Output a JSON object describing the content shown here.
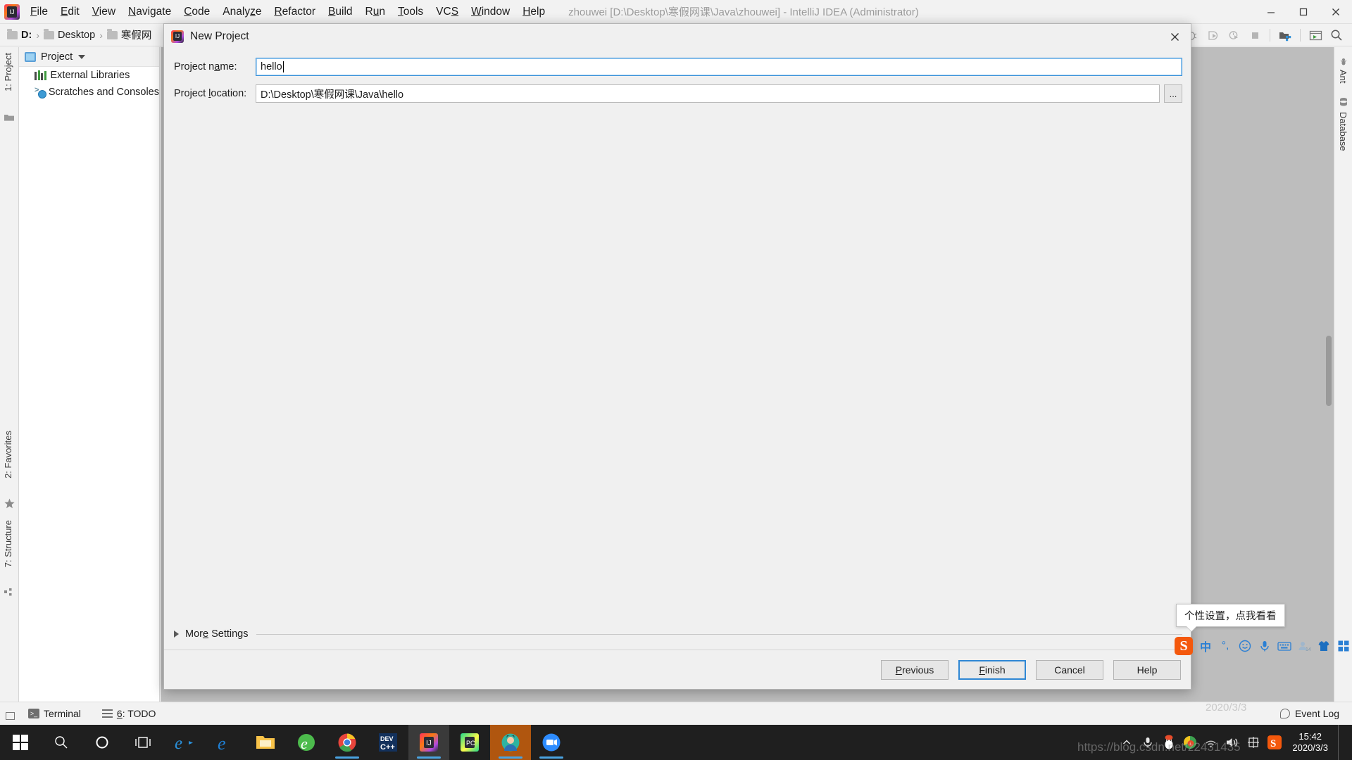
{
  "window": {
    "title": "zhouwei [D:\\Desktop\\寒假网课\\Java\\zhouwei] - IntelliJ IDEA (Administrator)",
    "logo_text": "IJ",
    "controls": {
      "minimize": "minimize-icon",
      "maximize": "maximize-icon",
      "close": "close-icon"
    }
  },
  "menubar": {
    "items": [
      {
        "label": "File",
        "mnemonic": "F"
      },
      {
        "label": "Edit",
        "mnemonic": "E"
      },
      {
        "label": "View",
        "mnemonic": "V"
      },
      {
        "label": "Navigate",
        "mnemonic": "N"
      },
      {
        "label": "Code",
        "mnemonic": "C"
      },
      {
        "label": "Analyze",
        "mnemonic": "z"
      },
      {
        "label": "Refactor",
        "mnemonic": "R"
      },
      {
        "label": "Build",
        "mnemonic": "B"
      },
      {
        "label": "Run",
        "mnemonic": "u"
      },
      {
        "label": "Tools",
        "mnemonic": "T"
      },
      {
        "label": "VCS",
        "mnemonic": "S"
      },
      {
        "label": "Window",
        "mnemonic": "W"
      },
      {
        "label": "Help",
        "mnemonic": "H"
      }
    ]
  },
  "navbar": {
    "breadcrumb": [
      {
        "label": "D:",
        "bold": true
      },
      {
        "label": "Desktop",
        "bold": false
      },
      {
        "label": "寒假网",
        "bold": false
      }
    ],
    "toolbar_icons": [
      "debug-icon",
      "run-with-coverage-icon",
      "profile-icon",
      "stop-icon",
      "project-structure-icon",
      "terminal-icon",
      "search-icon"
    ]
  },
  "left_strip": {
    "project_label": "1: Project",
    "project_mnemonic": "1",
    "favorites_label": "2: Favorites",
    "favorites_mnemonic": "2",
    "structure_label": "7: Structure",
    "structure_mnemonic": "7",
    "icons": [
      "folder-icon",
      "star-icon",
      "structure-icon"
    ]
  },
  "right_strip": {
    "items": [
      {
        "label": "Ant",
        "icon": "ant-icon"
      },
      {
        "label": "Database",
        "icon": "database-icon"
      }
    ]
  },
  "project_panel": {
    "header_label": "Project",
    "header_icon": "project-window-icon",
    "dropdown_icon": "chevron-down-icon",
    "tree": [
      {
        "label": "External Libraries",
        "icon": "external-libraries-icon"
      },
      {
        "label": "Scratches and Consoles",
        "icon": "scratches-icon"
      }
    ]
  },
  "dialog": {
    "title": "New Project",
    "logo_text": "IJ",
    "close_label": "close-icon",
    "fields": [
      {
        "label_pre": "Project n",
        "label_mnemonic": "a",
        "label_post": "me:",
        "value": "hello",
        "focused": true,
        "has_caret": true
      },
      {
        "label_pre": "Project ",
        "label_mnemonic": "l",
        "label_post": "ocation:",
        "value": "D:\\Desktop\\寒假网课\\Java\\hello",
        "focused": false,
        "has_caret": false
      }
    ],
    "browse_button_label": "...",
    "more_settings": {
      "label_pre": "Mor",
      "label_mnemonic": "e",
      "label_post": " Settings",
      "expanded": false
    },
    "buttons": [
      {
        "label_pre": "",
        "label_mnemonic": "P",
        "label_post": "revious",
        "default": false
      },
      {
        "label_pre": "",
        "label_mnemonic": "F",
        "label_post": "inish",
        "default": true
      },
      {
        "label_pre": "Cancel",
        "label_mnemonic": "",
        "label_post": "",
        "default": false
      },
      {
        "label_pre": "Help",
        "label_mnemonic": "",
        "label_post": "",
        "default": false
      }
    ]
  },
  "statusbar": {
    "terminal_label": "Terminal",
    "todo_label": "6: TODO",
    "todo_mnemonic": "6",
    "event_log_label": "Event Log"
  },
  "ime": {
    "tooltip_text": "个性设置，点我看看",
    "logo_text": "S",
    "buttons": [
      {
        "icon": "chinese-mode-icon",
        "glyph": "中"
      },
      {
        "icon": "punctuation-mode-icon",
        "glyph": "°,"
      },
      {
        "icon": "emoji-icon",
        "glyph": "☺"
      },
      {
        "icon": "voice-input-icon",
        "glyph": "🎤"
      },
      {
        "icon": "soft-keyboard-icon",
        "glyph": "⌨"
      },
      {
        "icon": "user-icon",
        "glyph": "👤"
      },
      {
        "icon": "skin-icon",
        "glyph": "👕"
      },
      {
        "icon": "toolbox-icon",
        "glyph": "▦"
      }
    ]
  },
  "taskbar": {
    "items": [
      {
        "name": "start-button",
        "glyph": ""
      },
      {
        "name": "search-button",
        "glyph": "🔍"
      },
      {
        "name": "cortana-button",
        "glyph": "◯"
      },
      {
        "name": "task-view-button",
        "glyph": "❑"
      },
      {
        "name": "internet-explorer-button",
        "glyph": "e"
      },
      {
        "name": "edge-button",
        "glyph": "e"
      },
      {
        "name": "file-explorer-button",
        "glyph": "📁"
      },
      {
        "name": "browser-360-button",
        "glyph": "e"
      },
      {
        "name": "chrome-button",
        "glyph": "◎"
      },
      {
        "name": "devcpp-button",
        "glyph": "DEV"
      },
      {
        "name": "intellij-idea-button",
        "glyph": "IJ"
      },
      {
        "name": "pycharm-button",
        "glyph": "PC"
      },
      {
        "name": "meeting-button",
        "glyph": "◕"
      },
      {
        "name": "video-button",
        "glyph": "▣"
      }
    ],
    "tray": [
      {
        "name": "show-hidden-icons",
        "glyph": "⌃"
      },
      {
        "name": "microphone-icon",
        "glyph": "🎙"
      },
      {
        "name": "qq-icon",
        "glyph": "🐧"
      },
      {
        "name": "360-safe-icon",
        "glyph": "●"
      },
      {
        "name": "network-icon",
        "glyph": "◞"
      },
      {
        "name": "volume-icon",
        "glyph": "🔊"
      },
      {
        "name": "ime-indicator-icon",
        "glyph": "中"
      },
      {
        "name": "sogou-tray-icon",
        "glyph": "S"
      }
    ],
    "clock_time": "15:42",
    "clock_date": "2020/3/3"
  },
  "watermark": {
    "text": "https://blog.csdn.net/z2431435",
    "text2": "2020/3/3"
  }
}
